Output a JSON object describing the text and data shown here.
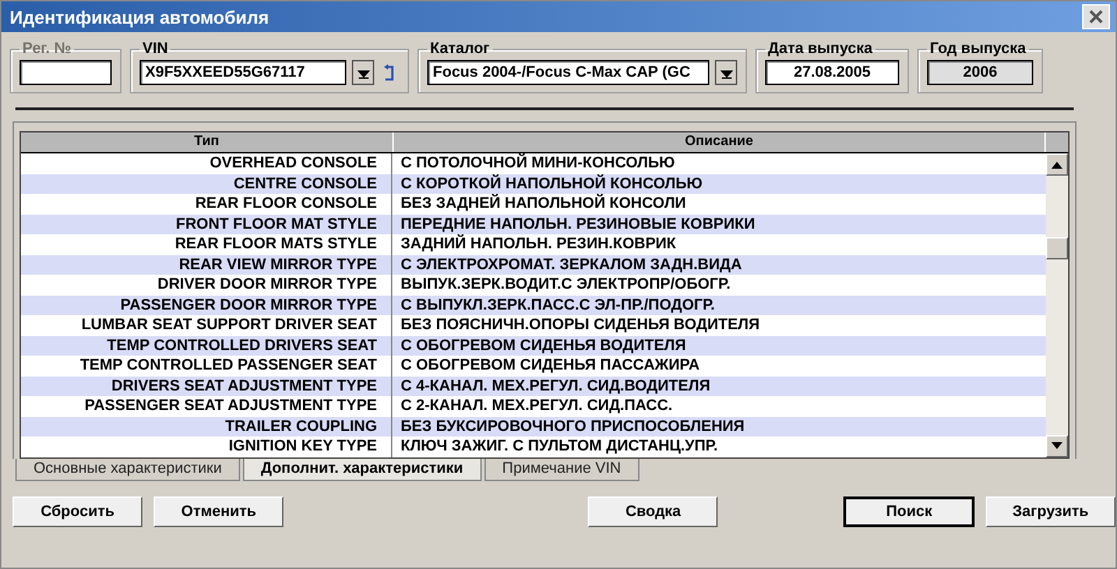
{
  "window": {
    "title": "Идентификация автомобиля"
  },
  "fields": [
    {
      "label": "Рег. №",
      "disabled": true,
      "readonly": false,
      "kind": "text"
    },
    {
      "label": "VIN",
      "value": "X9F5XXEED55G67117",
      "disabled": false,
      "readonly": false,
      "kind": "vin"
    },
    {
      "label": "Каталог",
      "value": "Focus 2004-/Focus C-Max CAP (GC",
      "disabled": false,
      "readonly": false,
      "kind": "combo"
    },
    {
      "label": "Дата выпуска",
      "value": "27.08.2005",
      "disabled": false,
      "readonly": false,
      "kind": "date"
    },
    {
      "label": "Год выпуска",
      "value": "2006",
      "disabled": false,
      "readonly": true,
      "kind": "date"
    }
  ],
  "table": {
    "columns": [
      "Тип",
      "Описание"
    ],
    "rows": [
      [
        "OVERHEAD CONSOLE",
        "С ПОТОЛОЧНОЙ МИНИ-КОНСОЛЬЮ"
      ],
      [
        "CENTRE CONSOLE",
        "С КОРОТКОЙ НАПОЛЬНОЙ КОНСОЛЬЮ"
      ],
      [
        "REAR FLOOR CONSOLE",
        "БЕЗ ЗАДНЕЙ НАПОЛЬНОЙ КОНСОЛИ"
      ],
      [
        "FRONT FLOOR MAT STYLE",
        "ПЕРЕДНИЕ НАПОЛЬН. РЕЗИНОВЫЕ КОВРИКИ"
      ],
      [
        "REAR FLOOR MATS STYLE",
        "ЗАДНИЙ НАПОЛЬН. РЕЗИН.КОВРИК"
      ],
      [
        "REAR VIEW MIRROR TYPE",
        "С ЭЛЕКТРОХРОМАТ. ЗЕРКАЛОМ ЗАДН.ВИДА"
      ],
      [
        "DRIVER DOOR MIRROR TYPE",
        "ВЫПУК.ЗЕРК.ВОДИТ.С ЭЛЕКТРОПР/ОБОГР."
      ],
      [
        "PASSENGER DOOR MIRROR TYPE",
        "С ВЫПУКЛ.ЗЕРК.ПАСС.С ЭЛ-ПР./ПОДОГР."
      ],
      [
        "LUMBAR SEAT SUPPORT DRIVER SEAT",
        "БЕЗ ПОЯСНИЧН.ОПОРЫ СИДЕНЬЯ ВОДИТЕЛЯ"
      ],
      [
        "TEMP CONTROLLED DRIVERS SEAT",
        "С ОБОГРЕВОМ СИДЕНЬЯ ВОДИТЕЛЯ"
      ],
      [
        "TEMP CONTROLLED PASSENGER SEAT",
        "С ОБОГРЕВОМ СИДЕНЬЯ ПАССАЖИРА"
      ],
      [
        "DRIVERS SEAT ADJUSTMENT TYPE",
        "С 4-КАНАЛ. МЕХ.РЕГУЛ. СИД.ВОДИТЕЛЯ"
      ],
      [
        "PASSENGER SEAT ADJUSTMENT TYPE",
        "С 2-КАНАЛ. МЕХ.РЕГУЛ. СИД.ПАСС."
      ],
      [
        "TRAILER COUPLING",
        "БЕЗ БУКСИРОВОЧНОГО ПРИСПОСОБЛЕНИЯ"
      ],
      [
        "IGNITION KEY TYPE",
        "КЛЮЧ ЗАЖИГ. С ПУЛЬТОМ ДИСТАНЦ.УПР."
      ]
    ]
  },
  "tabs": [
    {
      "label": "Основные характеристики",
      "selected": false
    },
    {
      "label": "Дополнит. характеристики",
      "selected": true
    },
    {
      "label": "Примечание VIN",
      "selected": false
    }
  ],
  "buttons": [
    {
      "label": "Сбросить",
      "default": false
    },
    {
      "label": "Отменить",
      "default": false
    },
    {
      "label": "Сводка",
      "default": false
    },
    {
      "label": "Поиск",
      "default": true
    },
    {
      "label": "Загрузить",
      "default": false
    }
  ]
}
